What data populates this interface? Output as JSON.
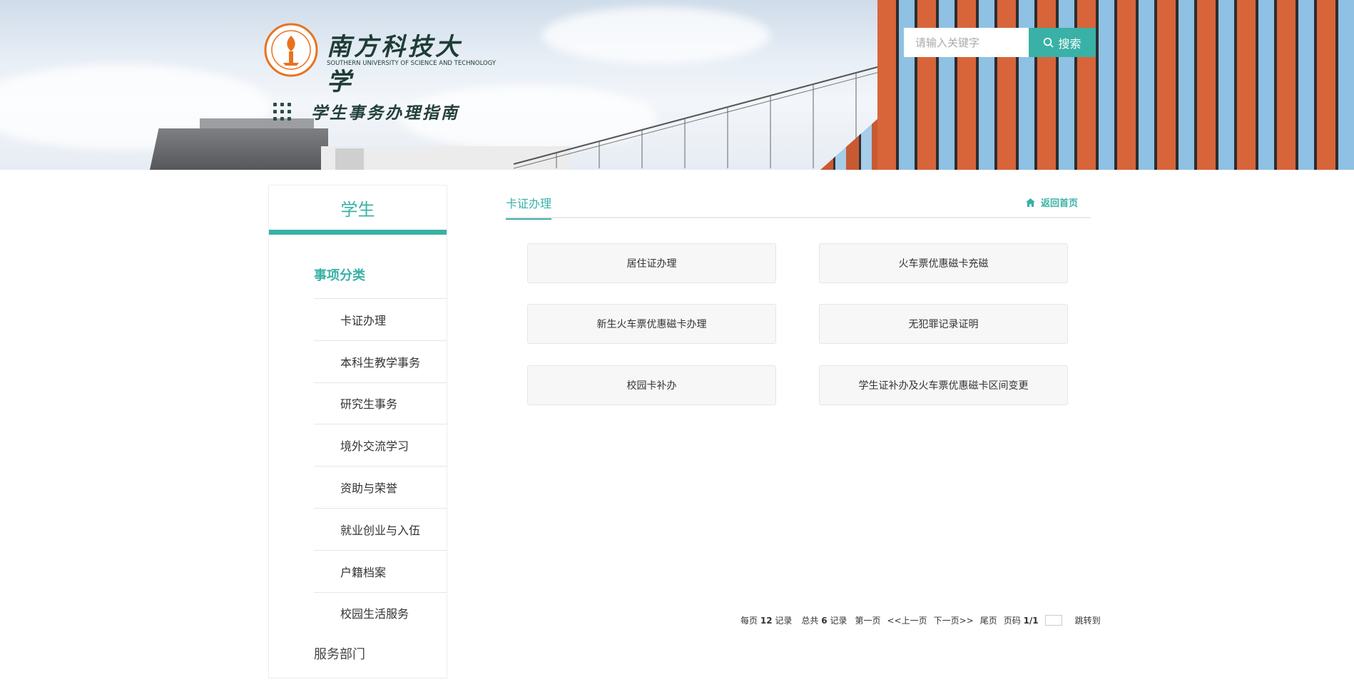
{
  "header": {
    "school_name_cn": "南方科技大学",
    "school_name_en": "SOUTHERN UNIVERSITY OF SCIENCE AND TECHNOLOGY",
    "guide_title": "学生事务办理指南",
    "search_placeholder": "请输入关键字",
    "search_button": "搜索"
  },
  "sidebar": {
    "title": "学生",
    "category_title": "事项分类",
    "items": [
      {
        "label": "卡证办理"
      },
      {
        "label": "本科生教学事务"
      },
      {
        "label": "研究生事务"
      },
      {
        "label": "境外交流学习"
      },
      {
        "label": "资助与荣誉"
      },
      {
        "label": "就业创业与入伍"
      },
      {
        "label": "户籍档案"
      },
      {
        "label": "校园生活服务"
      }
    ],
    "service_label": "服务部门"
  },
  "main": {
    "tab_label": "卡证办理",
    "home_link": "返回首页",
    "cards": [
      {
        "label": "居住证办理"
      },
      {
        "label": "火车票优惠磁卡充磁"
      },
      {
        "label": "新生火车票优惠磁卡办理"
      },
      {
        "label": "无犯罪记录证明"
      },
      {
        "label": "校园卡补办"
      },
      {
        "label": "学生证补办及火车票优惠磁卡区间变更"
      }
    ]
  },
  "pager": {
    "per_page_prefix": "每页",
    "per_page": "12",
    "per_page_suffix": "记录",
    "total_prefix": "总共",
    "total": "6",
    "total_suffix": "记录",
    "first": "第一页",
    "prev": "<<上一页",
    "next": "下一页>>",
    "last": "尾页",
    "page_prefix": "页码",
    "page_value": "1/1",
    "jump": "跳转到"
  },
  "colors": {
    "accent": "#39b1a6",
    "logo_orange": "#e8731f"
  }
}
